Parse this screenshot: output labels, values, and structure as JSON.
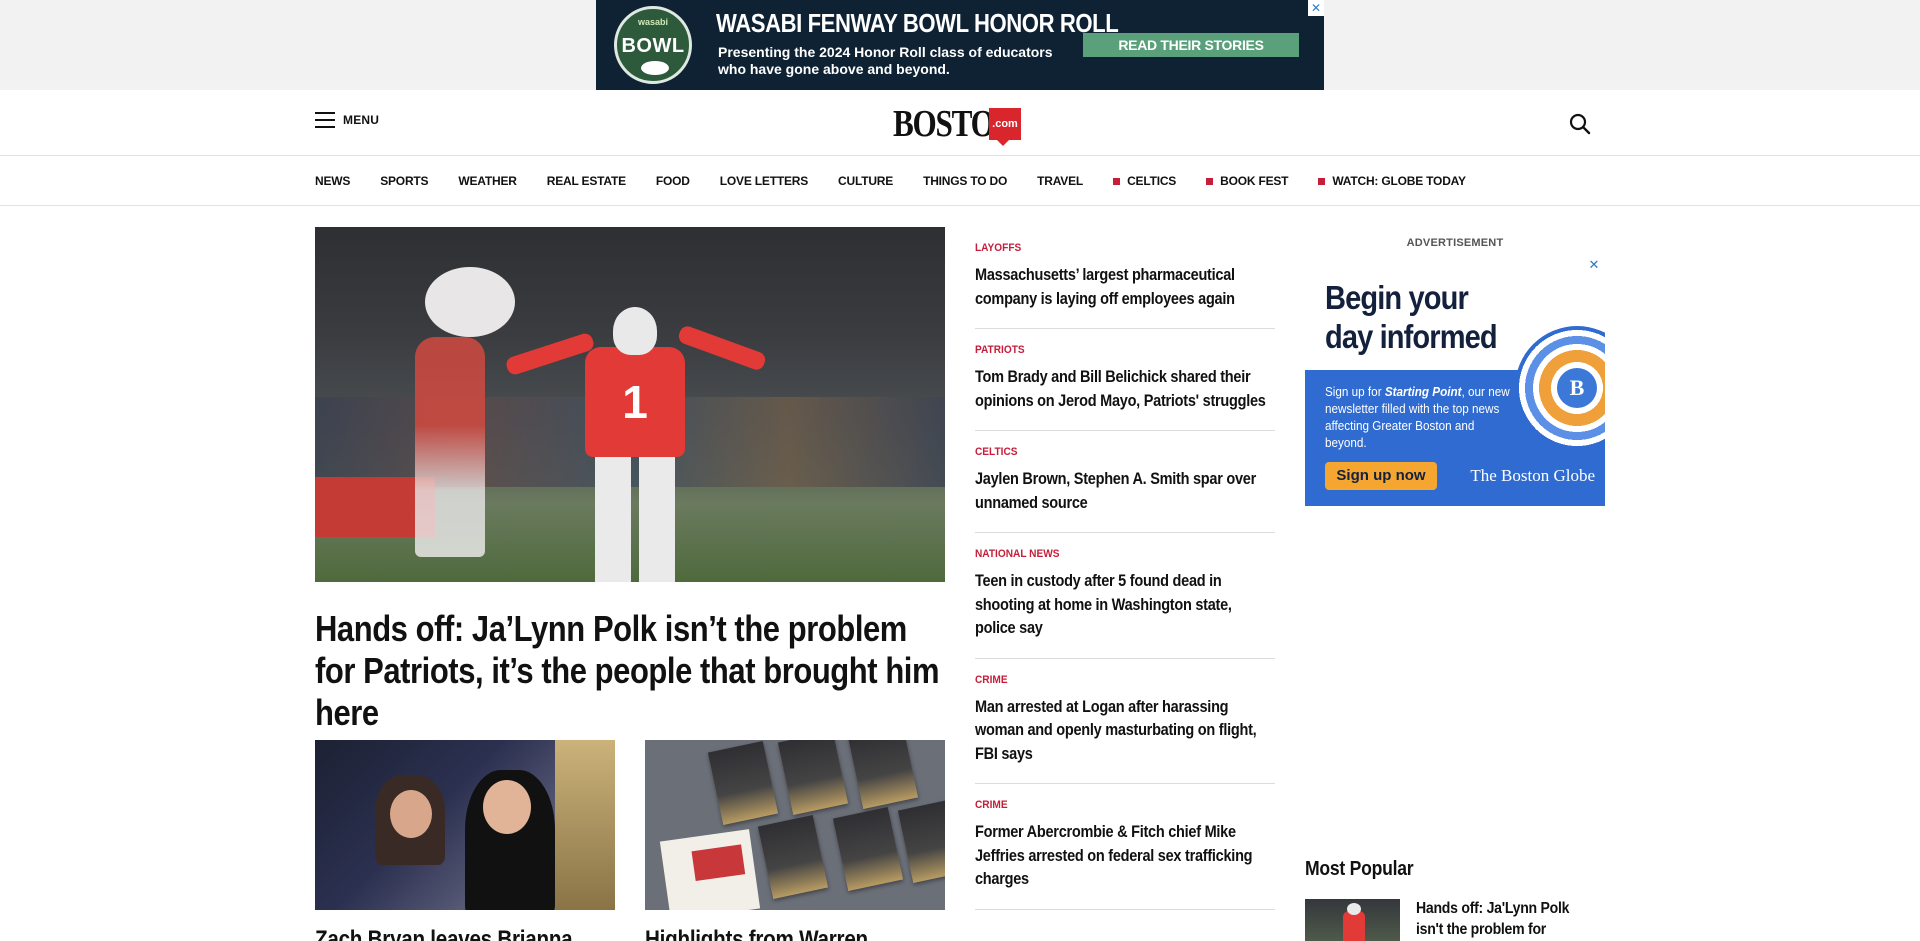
{
  "top_ad": {
    "badge_top": "wasabi",
    "badge_main": "BOWL",
    "title": "WASABI FENWAY BOWL HONOR ROLL",
    "subtitle": "Presenting the 2024 Honor Roll class of educators who have gone above and beyond.",
    "cta": "READ THEIR STORIES",
    "close": "✕"
  },
  "header": {
    "menu_label": "MENU",
    "logo_word": "BOSTON",
    "logo_com": ".com"
  },
  "nav": {
    "items": [
      {
        "label": "NEWS",
        "dot": false
      },
      {
        "label": "SPORTS",
        "dot": false
      },
      {
        "label": "WEATHER",
        "dot": false
      },
      {
        "label": "REAL ESTATE",
        "dot": false
      },
      {
        "label": "FOOD",
        "dot": false
      },
      {
        "label": "LOVE LETTERS",
        "dot": false
      },
      {
        "label": "CULTURE",
        "dot": false
      },
      {
        "label": "THINGS TO DO",
        "dot": false
      },
      {
        "label": "TRAVEL",
        "dot": false
      },
      {
        "label": "CELTICS",
        "dot": true
      },
      {
        "label": "BOOK FEST",
        "dot": true
      },
      {
        "label": "WATCH: GLOBE TODAY",
        "dot": true
      }
    ]
  },
  "hero": {
    "jersey_number": "1",
    "title": "Hands off: Ja’Lynn Polk isn’t the problem for Patriots, it’s the people that brought him here"
  },
  "sub_stories": [
    {
      "title": "Zach Bryan leaves Brianna"
    },
    {
      "title": "Highlights from Warren"
    }
  ],
  "headlines": [
    {
      "category": "LAYOFFS",
      "title": "Massachusetts’ largest pharmaceutical company is laying off employees again"
    },
    {
      "category": "PATRIOTS",
      "title": "Tom Brady and Bill Belichick shared their opinions on Jerod Mayo, Patriots' struggles"
    },
    {
      "category": "CELTICS",
      "title": "Jaylen Brown, Stephen A. Smith spar over unnamed source"
    },
    {
      "category": "NATIONAL NEWS",
      "title": "Teen in custody after 5 found dead in shooting at home in Washington state, police say"
    },
    {
      "category": "CRIME",
      "title": "Man arrested at Logan after harassing woman and openly masturbating on flight, FBI says"
    },
    {
      "category": "CRIME",
      "title": "Former Abercrombie & Fitch chief Mike Jeffries arrested on federal sex trafficking charges"
    }
  ],
  "rail": {
    "ad_label": "ADVERTISEMENT",
    "ad_headline": "Begin your day informed",
    "ad_copy_pre": "Sign up for ",
    "ad_copy_bold": "Starting Point",
    "ad_copy_post": ", our new newsletter filled with the top news affecting Greater Boston and beyond.",
    "ad_button": "Sign up now",
    "ad_brand": "The Boston Globe",
    "ad_badge": "B",
    "ad_close": "✕",
    "popular_heading": "Most Popular",
    "popular_first_title": "Hands off: Ja'Lynn Polk isn't the problem for"
  },
  "colors": {
    "accent_red": "#c41e3a",
    "logo_red": "#d8262c",
    "ad_blue": "#2f6bd0"
  }
}
